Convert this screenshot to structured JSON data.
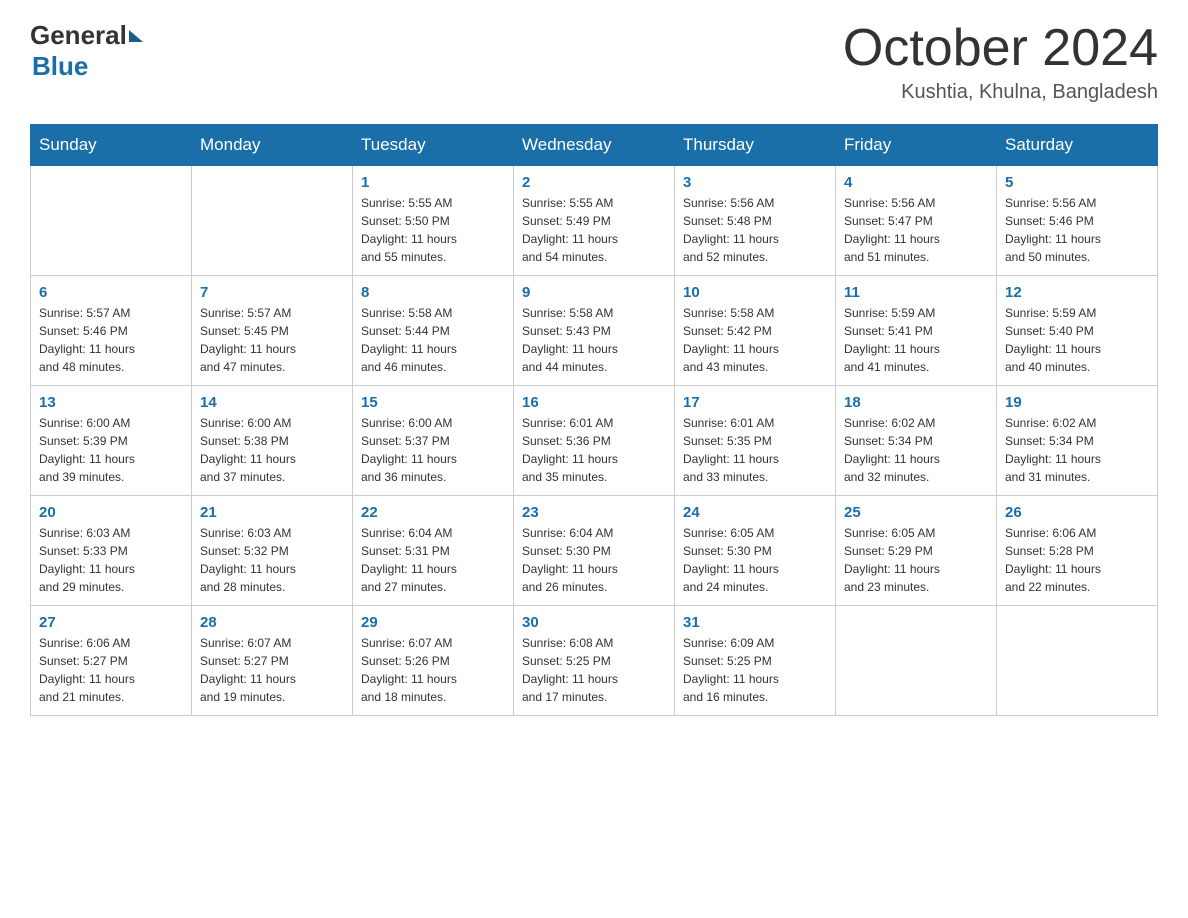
{
  "header": {
    "logo_line1": "General",
    "logo_line2": "Blue",
    "month_title": "October 2024",
    "location": "Kushtia, Khulna, Bangladesh"
  },
  "weekdays": [
    "Sunday",
    "Monday",
    "Tuesday",
    "Wednesday",
    "Thursday",
    "Friday",
    "Saturday"
  ],
  "weeks": [
    [
      {
        "day": "",
        "info": ""
      },
      {
        "day": "",
        "info": ""
      },
      {
        "day": "1",
        "info": "Sunrise: 5:55 AM\nSunset: 5:50 PM\nDaylight: 11 hours\nand 55 minutes."
      },
      {
        "day": "2",
        "info": "Sunrise: 5:55 AM\nSunset: 5:49 PM\nDaylight: 11 hours\nand 54 minutes."
      },
      {
        "day": "3",
        "info": "Sunrise: 5:56 AM\nSunset: 5:48 PM\nDaylight: 11 hours\nand 52 minutes."
      },
      {
        "day": "4",
        "info": "Sunrise: 5:56 AM\nSunset: 5:47 PM\nDaylight: 11 hours\nand 51 minutes."
      },
      {
        "day": "5",
        "info": "Sunrise: 5:56 AM\nSunset: 5:46 PM\nDaylight: 11 hours\nand 50 minutes."
      }
    ],
    [
      {
        "day": "6",
        "info": "Sunrise: 5:57 AM\nSunset: 5:46 PM\nDaylight: 11 hours\nand 48 minutes."
      },
      {
        "day": "7",
        "info": "Sunrise: 5:57 AM\nSunset: 5:45 PM\nDaylight: 11 hours\nand 47 minutes."
      },
      {
        "day": "8",
        "info": "Sunrise: 5:58 AM\nSunset: 5:44 PM\nDaylight: 11 hours\nand 46 minutes."
      },
      {
        "day": "9",
        "info": "Sunrise: 5:58 AM\nSunset: 5:43 PM\nDaylight: 11 hours\nand 44 minutes."
      },
      {
        "day": "10",
        "info": "Sunrise: 5:58 AM\nSunset: 5:42 PM\nDaylight: 11 hours\nand 43 minutes."
      },
      {
        "day": "11",
        "info": "Sunrise: 5:59 AM\nSunset: 5:41 PM\nDaylight: 11 hours\nand 41 minutes."
      },
      {
        "day": "12",
        "info": "Sunrise: 5:59 AM\nSunset: 5:40 PM\nDaylight: 11 hours\nand 40 minutes."
      }
    ],
    [
      {
        "day": "13",
        "info": "Sunrise: 6:00 AM\nSunset: 5:39 PM\nDaylight: 11 hours\nand 39 minutes."
      },
      {
        "day": "14",
        "info": "Sunrise: 6:00 AM\nSunset: 5:38 PM\nDaylight: 11 hours\nand 37 minutes."
      },
      {
        "day": "15",
        "info": "Sunrise: 6:00 AM\nSunset: 5:37 PM\nDaylight: 11 hours\nand 36 minutes."
      },
      {
        "day": "16",
        "info": "Sunrise: 6:01 AM\nSunset: 5:36 PM\nDaylight: 11 hours\nand 35 minutes."
      },
      {
        "day": "17",
        "info": "Sunrise: 6:01 AM\nSunset: 5:35 PM\nDaylight: 11 hours\nand 33 minutes."
      },
      {
        "day": "18",
        "info": "Sunrise: 6:02 AM\nSunset: 5:34 PM\nDaylight: 11 hours\nand 32 minutes."
      },
      {
        "day": "19",
        "info": "Sunrise: 6:02 AM\nSunset: 5:34 PM\nDaylight: 11 hours\nand 31 minutes."
      }
    ],
    [
      {
        "day": "20",
        "info": "Sunrise: 6:03 AM\nSunset: 5:33 PM\nDaylight: 11 hours\nand 29 minutes."
      },
      {
        "day": "21",
        "info": "Sunrise: 6:03 AM\nSunset: 5:32 PM\nDaylight: 11 hours\nand 28 minutes."
      },
      {
        "day": "22",
        "info": "Sunrise: 6:04 AM\nSunset: 5:31 PM\nDaylight: 11 hours\nand 27 minutes."
      },
      {
        "day": "23",
        "info": "Sunrise: 6:04 AM\nSunset: 5:30 PM\nDaylight: 11 hours\nand 26 minutes."
      },
      {
        "day": "24",
        "info": "Sunrise: 6:05 AM\nSunset: 5:30 PM\nDaylight: 11 hours\nand 24 minutes."
      },
      {
        "day": "25",
        "info": "Sunrise: 6:05 AM\nSunset: 5:29 PM\nDaylight: 11 hours\nand 23 minutes."
      },
      {
        "day": "26",
        "info": "Sunrise: 6:06 AM\nSunset: 5:28 PM\nDaylight: 11 hours\nand 22 minutes."
      }
    ],
    [
      {
        "day": "27",
        "info": "Sunrise: 6:06 AM\nSunset: 5:27 PM\nDaylight: 11 hours\nand 21 minutes."
      },
      {
        "day": "28",
        "info": "Sunrise: 6:07 AM\nSunset: 5:27 PM\nDaylight: 11 hours\nand 19 minutes."
      },
      {
        "day": "29",
        "info": "Sunrise: 6:07 AM\nSunset: 5:26 PM\nDaylight: 11 hours\nand 18 minutes."
      },
      {
        "day": "30",
        "info": "Sunrise: 6:08 AM\nSunset: 5:25 PM\nDaylight: 11 hours\nand 17 minutes."
      },
      {
        "day": "31",
        "info": "Sunrise: 6:09 AM\nSunset: 5:25 PM\nDaylight: 11 hours\nand 16 minutes."
      },
      {
        "day": "",
        "info": ""
      },
      {
        "day": "",
        "info": ""
      }
    ]
  ]
}
